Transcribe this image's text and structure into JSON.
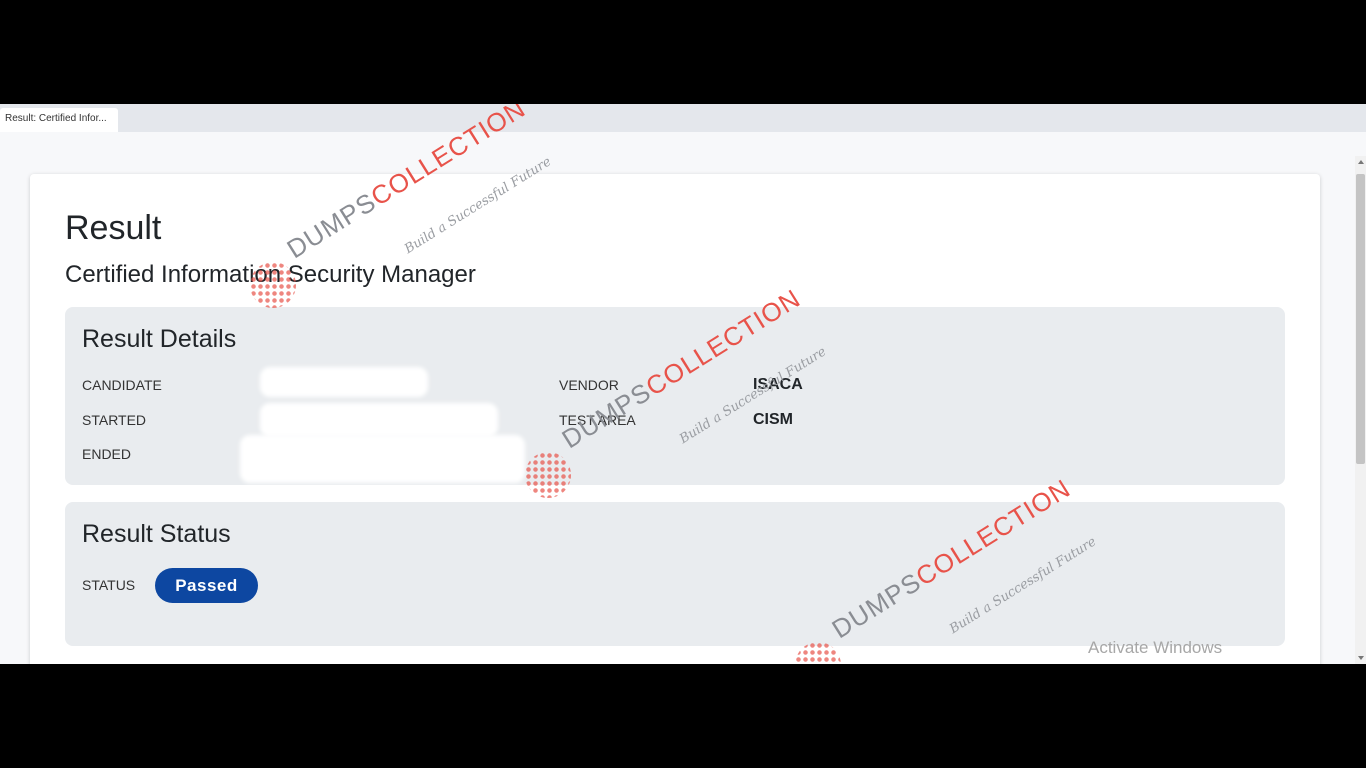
{
  "browser": {
    "tab_title": "Result: Certified Infor..."
  },
  "page": {
    "title": "Result",
    "subtitle": "Certified Information Security Manager"
  },
  "result_details": {
    "heading": "Result Details",
    "candidate_label": "CANDIDATE",
    "started_label": "STARTED",
    "ended_label": "ENDED",
    "vendor_label": "VENDOR",
    "vendor_value": "ISACA",
    "test_area_label": "TEST AREA",
    "test_area_value": "CISM"
  },
  "result_status": {
    "heading": "Result Status",
    "status_label": "STATUS",
    "status_value": "Passed",
    "status_color": "#0d47a1"
  },
  "watermark": {
    "brand_part1": "DUMPS",
    "brand_part2": "COLLECTION",
    "tagline": "Build a Successful Future",
    "accent_color": "#e8534a"
  },
  "os_overlay": {
    "activate_text": "Activate Windows"
  }
}
